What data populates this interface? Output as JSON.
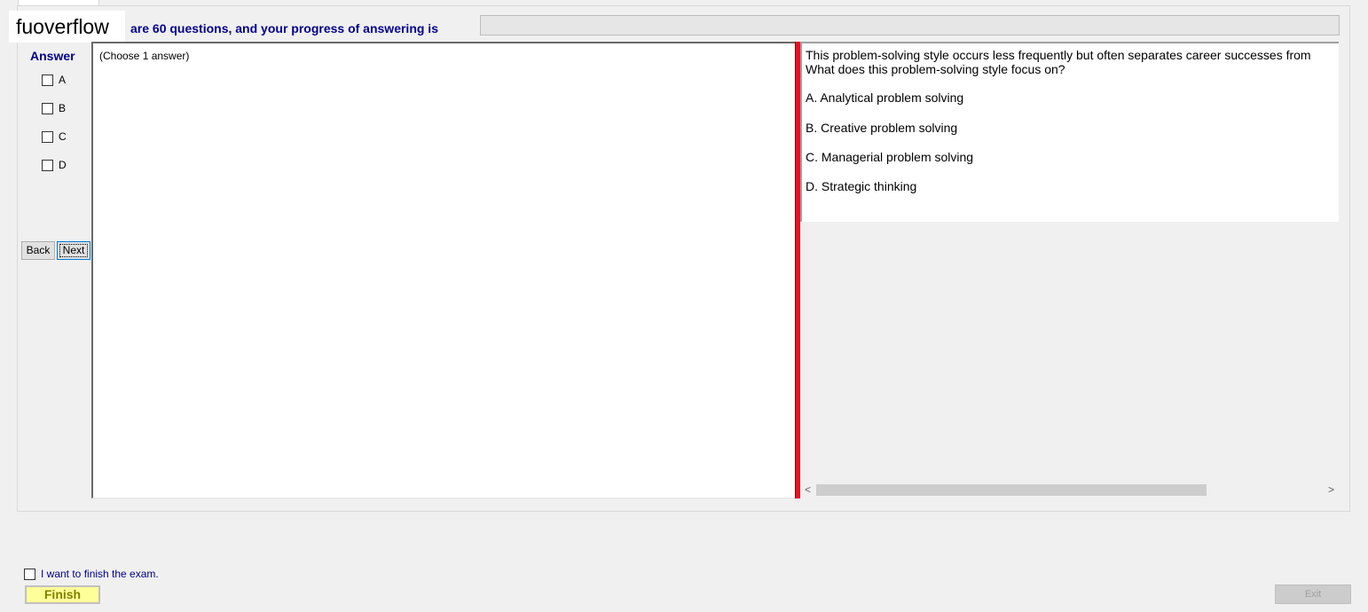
{
  "watermark": "fuoverflow",
  "header": {
    "progress_text": "are 60 questions, and your progress of answering is",
    "progress_value": 0
  },
  "answer": {
    "title": "Answer",
    "options": [
      "A",
      "B",
      "C",
      "D"
    ]
  },
  "nav": {
    "back_label": "Back",
    "next_label": "Next"
  },
  "choose_text": "(Choose 1 answer)",
  "question": {
    "line1": "This problem-solving style occurs less frequently but often separates career successes from",
    "line2": "What does this problem-solving style focus on?",
    "choices": [
      "A.  Analytical problem solving",
      "B.  Creative problem solving",
      "C.  Managerial problem solving",
      "D.  Strategic thinking"
    ]
  },
  "scroll": {
    "left_glyph": "<",
    "right_glyph": ">"
  },
  "footer": {
    "finish_checkbox_label": "I want to finish the exam.",
    "finish_button": "Finish",
    "exit_button": "Exit"
  },
  "colors": {
    "heading_blue": "#00008b",
    "splitter_red": "#e81123",
    "finish_yellow": "#ffff99"
  }
}
